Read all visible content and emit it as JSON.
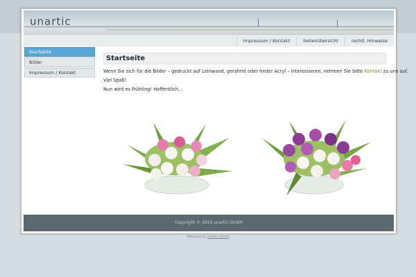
{
  "header": {
    "logo": "unartic"
  },
  "topnav": {
    "items": [
      {
        "label": "Impressum / Kontakt"
      },
      {
        "label": "Seitenübersicht"
      },
      {
        "label": "rechtl. Hinweise"
      }
    ]
  },
  "sidenav": {
    "items": [
      {
        "label": "Startseite",
        "active": true
      },
      {
        "label": "Bilder"
      },
      {
        "label": "Impressum / Kontakt"
      }
    ]
  },
  "main": {
    "title": "Startseite",
    "para1_before": "Wenn Sie sich für die Bilder – gedruckt auf Leinwand, gerahmt oder hinter Acryl – interessieren, nehmen Sie bitte ",
    "para1_link": "Kontakt",
    "para1_after": " zu uns auf.",
    "para2": "Viel Spaß!",
    "para3": "Nun wird es Frühling! Hoffentlich..."
  },
  "footer": {
    "copyright": "Copyright © 2016 unartic GmbH"
  },
  "credit": {
    "prefix": "Designed by ",
    "link": "unartic GmbH"
  },
  "colors": {
    "accent": "#5aa7d6",
    "link": "#6a9a3a",
    "footer": "#5a6870"
  }
}
